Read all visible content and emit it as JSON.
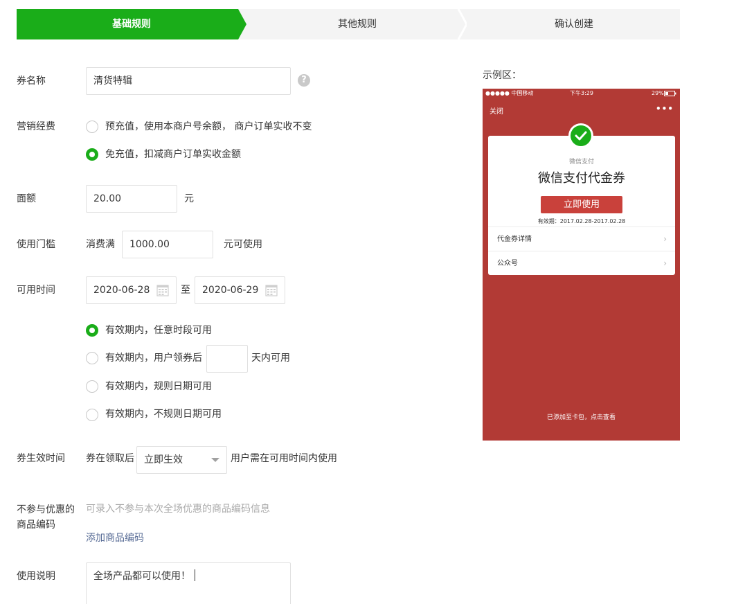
{
  "steps": [
    "基础规则",
    "其他规则",
    "确认创建"
  ],
  "form": {
    "coupon_name": {
      "label": "券名称",
      "value": "清货特辑",
      "help": "?"
    },
    "budget": {
      "label": "营销经费",
      "options": [
        {
          "text": "预充值，使用本商户号余额， 商户订单实收不变",
          "checked": false
        },
        {
          "text": "免充值，扣减商户订单实收金额",
          "checked": true
        }
      ]
    },
    "face_value": {
      "label": "面额",
      "value": "20.00",
      "unit": "元"
    },
    "threshold": {
      "label": "使用门槛",
      "prefix": "消费满",
      "value": "1000.00",
      "suffix": "元可使用"
    },
    "available_time": {
      "label": "可用时间",
      "start": "2020-06-28",
      "separator": "至",
      "end": "2020-06-29",
      "options": [
        {
          "text": "有效期内，任意时段可用",
          "checked": true
        },
        {
          "text_before": "有效期内，用户领券后",
          "input_value": "",
          "text_after": "天内可用",
          "checked": false
        },
        {
          "text": "有效期内，规则日期可用",
          "checked": false
        },
        {
          "text": "有效期内，不规则日期可用",
          "checked": false
        }
      ]
    },
    "effective_time": {
      "label": "券生效时间",
      "prefix": "券在领取后",
      "selected": "立即生效",
      "suffix": "用户需在可用时间内使用"
    },
    "excluded_goods": {
      "label_line1": "不参与优惠的",
      "label_line2": "商品编码",
      "placeholder": "可录入不参与本次全场优惠的商品编码信息",
      "add_link": "添加商品编码"
    },
    "usage_note": {
      "label": "使用说明",
      "value": "全场产品都可以使用！"
    }
  },
  "preview": {
    "label": "示例区：",
    "status_bar": {
      "carrier": "●●●●● 中国移动",
      "time": "下午3:29",
      "battery": "29%"
    },
    "nav_close": "关闭",
    "nav_more": "•••",
    "card": {
      "subtitle": "微信支付",
      "title": "微信支付代金券",
      "button": "立即使用",
      "validity": "有效期：2017.02.28-2017.02.28",
      "rows": [
        "代金券详情",
        "公众号"
      ],
      "chevron": "›"
    },
    "footer_note": "已添加至卡包，点击查看"
  },
  "colors": {
    "primary_green": "#1aad19",
    "preview_red": "#b23a35",
    "link_blue": "#576b95"
  }
}
